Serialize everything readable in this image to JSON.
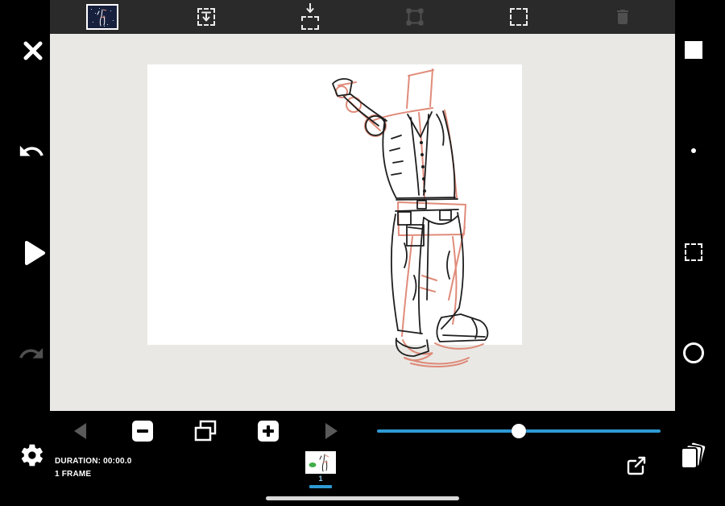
{
  "colors": {
    "accent": "#2f9ad6",
    "canvas_bg": "#e9e8e4",
    "topbar_bg": "#2a2a2a",
    "sketch_ink": "#1e1e1e",
    "sketch_guide": "#dd7f6c",
    "disabled_icon": "#4f4f4f",
    "onion_green": "#3fae49"
  },
  "top_toolbar": {
    "items": [
      {
        "id": "frame-preview-thumbnail",
        "selected": true
      },
      {
        "id": "insert-frame-before-icon",
        "enabled": true
      },
      {
        "id": "insert-frame-after-icon",
        "enabled": true
      },
      {
        "id": "transform-selection-icon",
        "enabled": false
      },
      {
        "id": "select-tool-icon",
        "enabled": true
      },
      {
        "id": "delete-frame-icon",
        "enabled": false
      }
    ]
  },
  "left_toolbar": {
    "items": [
      "close",
      "undo",
      "play",
      "redo",
      "settings"
    ]
  },
  "right_toolbar": {
    "items": [
      "color-swatch",
      "brush-size-dot",
      "select-tool",
      "circle-tool",
      "layers"
    ]
  },
  "playback": {
    "slider_pct": 50
  },
  "timeline": {
    "duration_label": "DURATION: 00:00.0",
    "frame_count_label": "1 FRAME",
    "frame_number": "1"
  }
}
